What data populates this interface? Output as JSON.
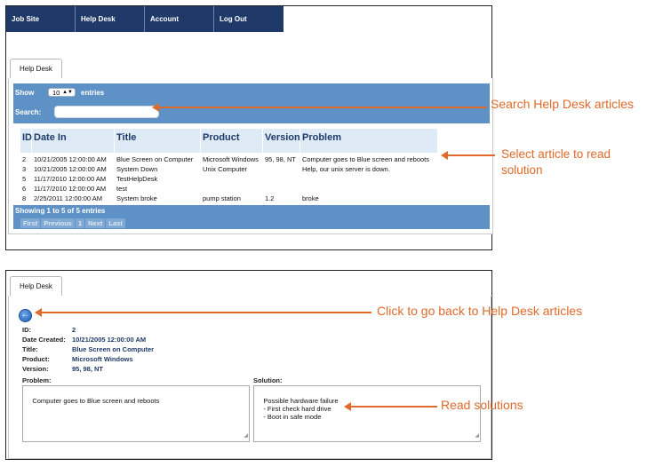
{
  "nav": [
    "Job Site",
    "Help Desk",
    "Account",
    "Log Out"
  ],
  "tab_label": "Help Desk",
  "list": {
    "show_label": "Show",
    "show_value": "10",
    "entries_label": "entries",
    "search_label": "Search:",
    "columns": [
      "ID",
      "Date In",
      "Title",
      "Product",
      "Version",
      "Problem"
    ],
    "rows": [
      [
        "2",
        "10/21/2005 12:00:00 AM",
        "Blue Screen on Computer",
        "Microsoft Windows",
        "95, 98, NT",
        "Computer goes to Blue screen and reboots"
      ],
      [
        "3",
        "10/21/2005 12:00:00 AM",
        "System Down",
        "Unix Computer",
        "",
        "Help, our unix server is down."
      ],
      [
        "5",
        "11/17/2010 12:00:00 AM",
        "TestHelpDesk",
        "",
        "",
        ""
      ],
      [
        "6",
        "11/17/2010 12:00:00 AM",
        "test",
        "",
        "",
        ""
      ],
      [
        "8",
        "2/25/2011 12:00:00 AM",
        "System broke",
        "pump station",
        "1.2",
        "broke"
      ]
    ],
    "info": "Showing 1 to 5 of 5 entries",
    "pager": [
      "First",
      "Previous",
      "1",
      "Next",
      "Last"
    ]
  },
  "detail": {
    "id_label": "ID:",
    "id": "2",
    "date_label": "Date Created:",
    "date": "10/21/2005 12:00:00 AM",
    "title_label": "Title:",
    "title": "Blue Screen on Computer",
    "product_label": "Product:",
    "product": "Microsoft Windows",
    "version_label": "Version:",
    "version": "95, 98, NT",
    "problem_label": "Problem:",
    "problem": "Computer goes to Blue screen and reboots",
    "solution_label": "Solution:",
    "solution": "Possible hardware failure\n    - First check hard drive\n    - Boot in safe mode"
  },
  "annotations": {
    "search": "Search Help Desk articles",
    "select_1": "Select article to read",
    "select_2": "solution",
    "back": "Click to go back to Help Desk articles",
    "read": "Read solutions"
  },
  "colors": {
    "nav_bg": "#1f3a68",
    "table_bar": "#5e92c6",
    "header_cell": "#deeaf6",
    "annotation": "#e06a2b"
  },
  "icons": [
    "back-arrow-icon",
    "resize-grip-icon",
    "select-arrows-icon"
  ]
}
